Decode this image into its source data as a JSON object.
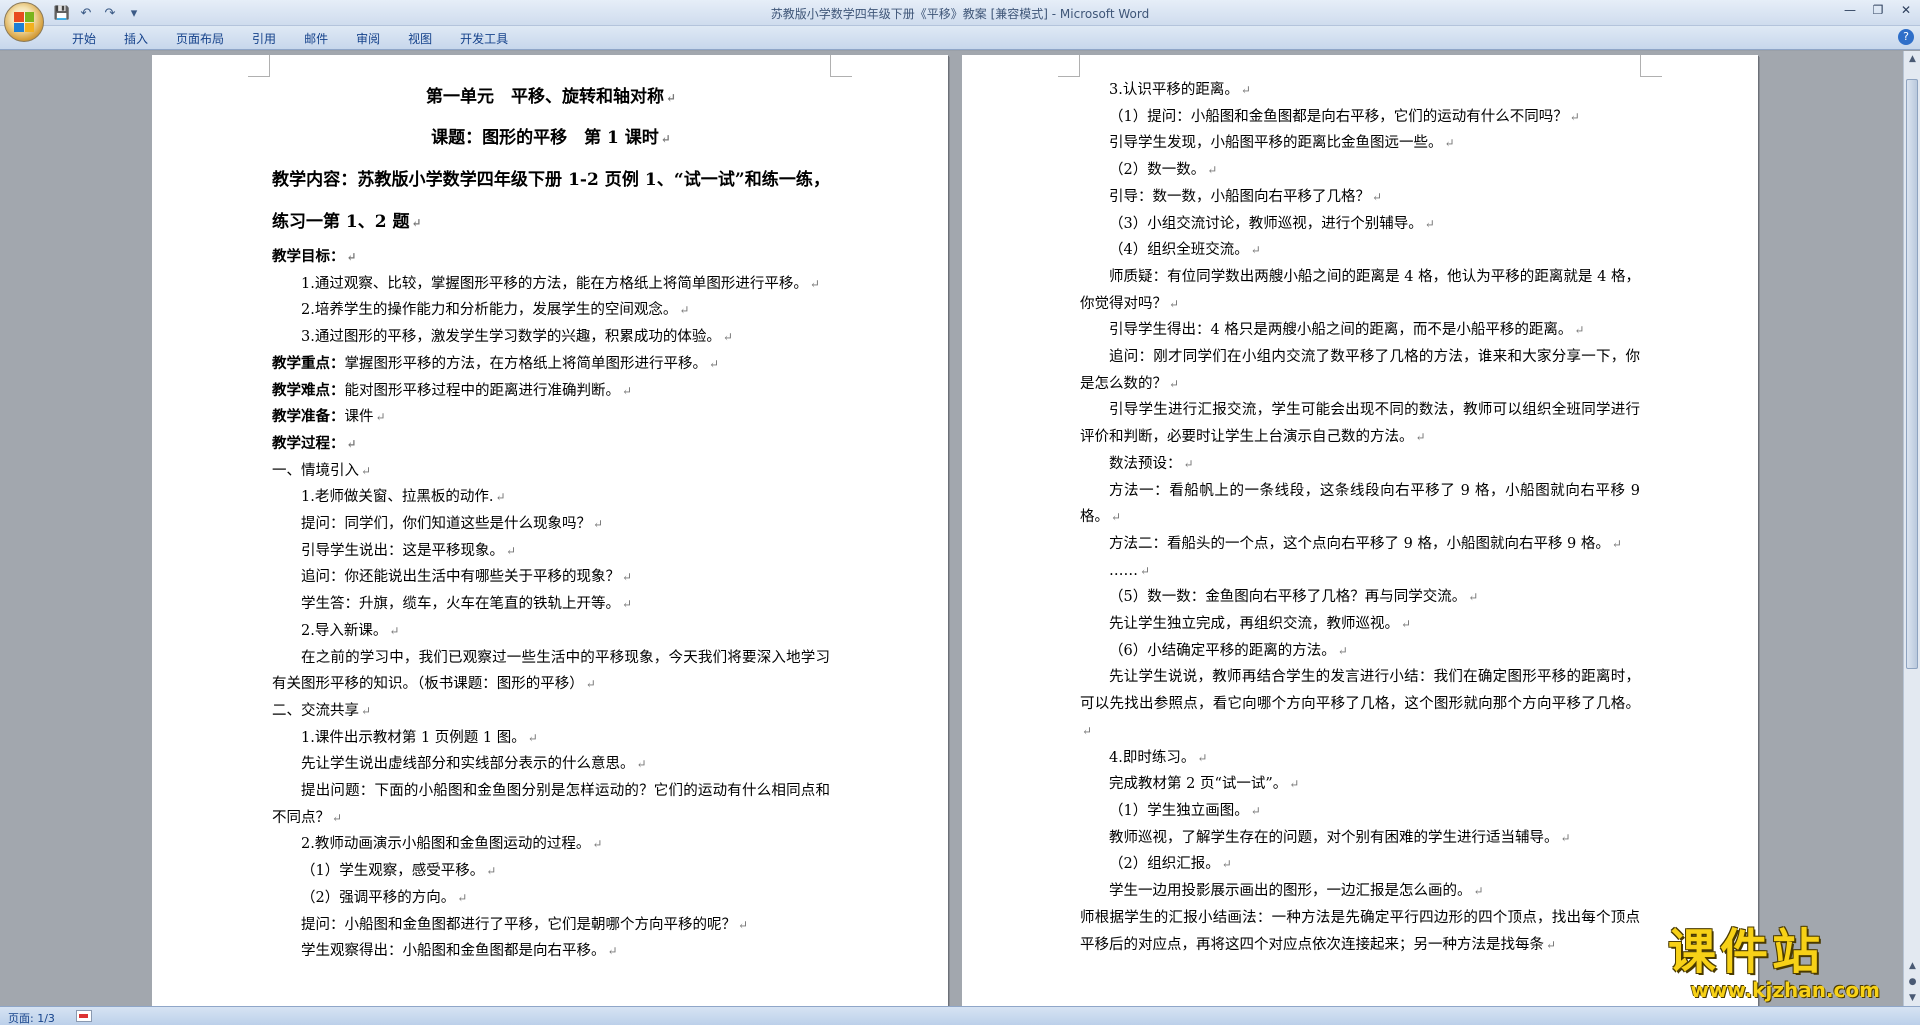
{
  "window": {
    "title": "苏教版小学数学四年级下册《平移》教案 [兼容模式] - Microsoft Word"
  },
  "ribbon": {
    "tabs": [
      "开始",
      "插入",
      "页面布局",
      "引用",
      "邮件",
      "审阅",
      "视图",
      "开发工具"
    ]
  },
  "status": {
    "pages": "页面: 1/3"
  },
  "watermark": {
    "name": "课件站",
    "url": "www.kjzhan.com"
  },
  "left_page": {
    "title": "第一单元　平移、旋转和轴对称",
    "subtitle": "课题：图形的平移　第 1 课时",
    "content_heading": "教学内容：苏教版小学数学四年级下册 1-2 页例 1、“试一试”和练一练，练习一第 1、2 题",
    "goals_label": "教学目标：",
    "goal1": "1.通过观察、比较，掌握图形平移的方法，能在方格纸上将简单图形进行平移。",
    "goal2": "2.培养学生的操作能力和分析能力，发展学生的空间观念。",
    "goal3": "3.通过图形的平移，激发学生学习数学的兴趣，积累成功的体验。",
    "key_label": "教学重点：",
    "key_text": "掌握图形平移的方法，在方格纸上将简单图形进行平移。",
    "diff_label": "教学难点：",
    "diff_text": "能对图形平移过程中的距离进行准确判断。",
    "prep_label": "教学准备：",
    "prep_text": "课件",
    "process_label": "教学过程：",
    "s1": "一、情境引入",
    "s1_1": "1.老师做关窗、拉黑板的动作.",
    "s1_2": "提问：同学们，你们知道这些是什么现象吗？",
    "s1_3": "引导学生说出：这是平移现象。",
    "s1_4": "追问：你还能说出生活中有哪些关于平移的现象？",
    "s1_5": "学生答：升旗，缆车，火车在笔直的铁轨上开等。",
    "s1_6": "2.导入新课。",
    "s1_7": "在之前的学习中，我们已观察过一些生活中的平移现象，今天我们将要深入地学习有关图形平移的知识。（板书课题：图形的平移）",
    "s2": "二、交流共享",
    "s2_1": "1.课件出示教材第 1 页例题 1 图。",
    "s2_2": "先让学生说出虚线部分和实线部分表示的什么意思。",
    "s2_3": "提出问题：下面的小船图和金鱼图分别是怎样运动的？它们的运动有什么相同点和不同点？",
    "s2_4": "2.教师动画演示小船图和金鱼图运动的过程。",
    "s2_5": "（1）学生观察，感受平移。",
    "s2_6": "（2）强调平移的方向。",
    "s2_7": "提问：小船图和金鱼图都进行了平移，它们是朝哪个方向平移的呢？",
    "s2_8": "学生观察得出：小船图和金鱼图都是向右平移。"
  },
  "right_page": {
    "r1": "3.认识平移的距离。",
    "r2": "（1）提问：小船图和金鱼图都是向右平移，它们的运动有什么不同吗？",
    "r3": "引导学生发现，小船图平移的距离比金鱼图远一些。",
    "r4": "（2）数一数。",
    "r5": "引导：数一数，小船图向右平移了几格？",
    "r6": "（3）小组交流讨论，教师巡视，进行个别辅导。",
    "r7": "（4）组织全班交流。",
    "r8": "师质疑：有位同学数出两艘小船之间的距离是 4 格，他认为平移的距离就是 4 格，你觉得对吗？",
    "r9": "引导学生得出：4 格只是两艘小船之间的距离，而不是小船平移的距离。",
    "r10": "追问：刚才同学们在小组内交流了数平移了几格的方法，谁来和大家分享一下，你是怎么数的？",
    "r11": "引导学生进行汇报交流，学生可能会出现不同的数法，教师可以组织全班同学进行评价和判断，必要时让学生上台演示自己数的方法。",
    "r12": "数法预设：",
    "r13": "方法一：看船帆上的一条线段，这条线段向右平移了 9 格，小船图就向右平移 9 格。",
    "r14": "方法二：看船头的一个点，这个点向右平移了 9 格，小船图就向右平移 9 格。",
    "r15": "……",
    "r16": "（5）数一数：金鱼图向右平移了几格？再与同学交流。",
    "r17": "先让学生独立完成，再组织交流，教师巡视。",
    "r18": "（6）小结确定平移的距离的方法。",
    "r19": "先让学生说说，教师再结合学生的发言进行小结：我们在确定图形平移的距离时，可以先找出参照点，看它向哪个方向平移了几格，这个图形就向那个方向平移了几格。",
    "r20": "4.即时练习。",
    "r21": "完成教材第 2 页“试一试”。",
    "r22": "（1）学生独立画图。",
    "r23": "教师巡视，了解学生存在的问题，对个别有困难的学生进行适当辅导。",
    "r24": "（2）组织汇报。",
    "r25": "学生一边用投影展示画出的图形，一边汇报是怎么画的。",
    "r26": "师根据学生的汇报小结画法：一种方法是先确定平行四边形的四个顶点，找出每个顶点平移后的对应点，再将这四个对应点依次连接起来；另一种方法是找每条"
  }
}
